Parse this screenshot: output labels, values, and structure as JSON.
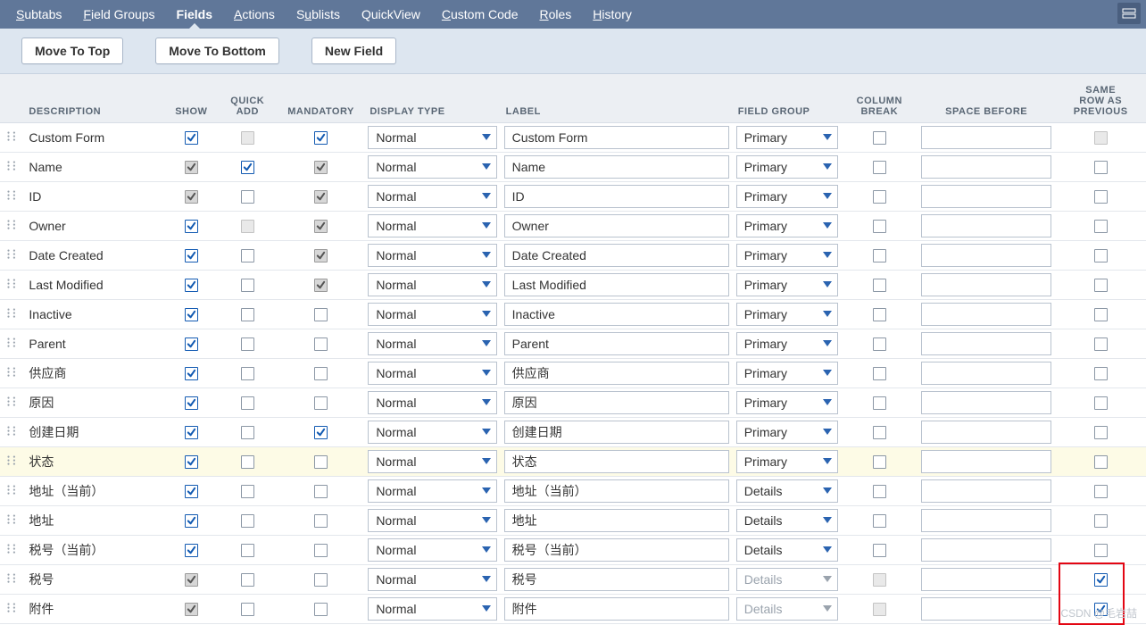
{
  "nav": {
    "tabs": [
      {
        "key": "subtabs",
        "label": "Subtabs",
        "u": 0,
        "active": false
      },
      {
        "key": "field-groups",
        "label": "Field Groups",
        "u": 0,
        "active": false
      },
      {
        "key": "fields",
        "label": "Fields",
        "u": -1,
        "active": true
      },
      {
        "key": "actions",
        "label": "Actions",
        "u": 0,
        "active": false
      },
      {
        "key": "sublists",
        "label": "Sublists",
        "u": 1,
        "active": false
      },
      {
        "key": "quickview",
        "label": "QuickView",
        "u": -1,
        "active": false
      },
      {
        "key": "custom-code",
        "label": "Custom Code",
        "u": 0,
        "active": false
      },
      {
        "key": "roles",
        "label": "Roles",
        "u": 0,
        "active": false
      },
      {
        "key": "history",
        "label": "History",
        "u": 0,
        "active": false
      }
    ]
  },
  "toolbar": {
    "move_top": "Move To Top",
    "move_bottom": "Move To Bottom",
    "new_field": "New Field"
  },
  "columns": {
    "description": "DESCRIPTION",
    "show": "SHOW",
    "quick_add": "QUICK\nADD",
    "mandatory": "MANDATORY",
    "display_type": "DISPLAY TYPE",
    "label": "LABEL",
    "field_group": "FIELD GROUP",
    "column_break": "COLUMN\nBREAK",
    "space_before": "SPACE BEFORE",
    "same_row": "SAME\nROW AS\nPREVIOUS"
  },
  "display_type_options": [
    "Normal"
  ],
  "field_group_options": [
    "Primary",
    "Details"
  ],
  "rows": [
    {
      "desc": "Custom Form",
      "show": "blue",
      "quick": "disabled",
      "mand": "blue",
      "display": "Normal",
      "label": "Custom Form",
      "group": "Primary",
      "groupDisabled": false,
      "colbreak": "off",
      "space": "",
      "same": "disabled",
      "hl": false
    },
    {
      "desc": "Name",
      "show": "gray",
      "quick": "blue",
      "mand": "gray",
      "display": "Normal",
      "label": "Name",
      "group": "Primary",
      "groupDisabled": false,
      "colbreak": "off",
      "space": "",
      "same": "off",
      "hl": false
    },
    {
      "desc": "ID",
      "show": "gray",
      "quick": "off",
      "mand": "gray",
      "display": "Normal",
      "label": "ID",
      "group": "Primary",
      "groupDisabled": false,
      "colbreak": "off",
      "space": "",
      "same": "off",
      "hl": false
    },
    {
      "desc": "Owner",
      "show": "blue",
      "quick": "disabled",
      "mand": "gray",
      "display": "Normal",
      "label": "Owner",
      "group": "Primary",
      "groupDisabled": false,
      "colbreak": "off",
      "space": "",
      "same": "off",
      "hl": false
    },
    {
      "desc": "Date Created",
      "show": "blue",
      "quick": "off",
      "mand": "gray",
      "display": "Normal",
      "label": "Date Created",
      "group": "Primary",
      "groupDisabled": false,
      "colbreak": "off",
      "space": "",
      "same": "off",
      "hl": false
    },
    {
      "desc": "Last Modified",
      "show": "blue",
      "quick": "off",
      "mand": "gray",
      "display": "Normal",
      "label": "Last Modified",
      "group": "Primary",
      "groupDisabled": false,
      "colbreak": "off",
      "space": "",
      "same": "off",
      "hl": false
    },
    {
      "desc": "Inactive",
      "show": "blue",
      "quick": "off",
      "mand": "off",
      "display": "Normal",
      "label": "Inactive",
      "group": "Primary",
      "groupDisabled": false,
      "colbreak": "off",
      "space": "",
      "same": "off",
      "hl": false
    },
    {
      "desc": "Parent",
      "show": "blue",
      "quick": "off",
      "mand": "off",
      "display": "Normal",
      "label": "Parent",
      "group": "Primary",
      "groupDisabled": false,
      "colbreak": "off",
      "space": "",
      "same": "off",
      "hl": false
    },
    {
      "desc": "供应商",
      "show": "blue",
      "quick": "off",
      "mand": "off",
      "display": "Normal",
      "label": "供应商",
      "group": "Primary",
      "groupDisabled": false,
      "colbreak": "off",
      "space": "",
      "same": "off",
      "hl": false
    },
    {
      "desc": "原因",
      "show": "blue",
      "quick": "off",
      "mand": "off",
      "display": "Normal",
      "label": "原因",
      "group": "Primary",
      "groupDisabled": false,
      "colbreak": "off",
      "space": "",
      "same": "off",
      "hl": false
    },
    {
      "desc": "创建日期",
      "show": "blue",
      "quick": "off",
      "mand": "blue",
      "display": "Normal",
      "label": "创建日期",
      "group": "Primary",
      "groupDisabled": false,
      "colbreak": "off",
      "space": "",
      "same": "off",
      "hl": false
    },
    {
      "desc": "状态",
      "show": "blue",
      "quick": "off",
      "mand": "off",
      "display": "Normal",
      "label": "状态",
      "group": "Primary",
      "groupDisabled": false,
      "colbreak": "off",
      "space": "",
      "same": "off",
      "hl": true
    },
    {
      "desc": "地址（当前）",
      "show": "blue",
      "quick": "off",
      "mand": "off",
      "display": "Normal",
      "label": "地址（当前）",
      "group": "Details",
      "groupDisabled": false,
      "colbreak": "off",
      "space": "",
      "same": "off",
      "hl": false
    },
    {
      "desc": "地址",
      "show": "blue",
      "quick": "off",
      "mand": "off",
      "display": "Normal",
      "label": "地址",
      "group": "Details",
      "groupDisabled": false,
      "colbreak": "off",
      "space": "",
      "same": "off",
      "hl": false
    },
    {
      "desc": "税号（当前）",
      "show": "blue",
      "quick": "off",
      "mand": "off",
      "display": "Normal",
      "label": "税号（当前）",
      "group": "Details",
      "groupDisabled": false,
      "colbreak": "off",
      "space": "",
      "same": "off",
      "hl": false
    },
    {
      "desc": "税号",
      "show": "gray",
      "quick": "off",
      "mand": "off",
      "display": "Normal",
      "label": "税号",
      "group": "Details",
      "groupDisabled": true,
      "colbreak": "disabled",
      "space": "",
      "same": "blue",
      "hl": false
    },
    {
      "desc": "附件",
      "show": "gray",
      "quick": "off",
      "mand": "off",
      "display": "Normal",
      "label": "附件",
      "group": "Details",
      "groupDisabled": true,
      "colbreak": "disabled",
      "space": "",
      "same": "blue",
      "hl": false
    }
  ],
  "highlight_box_rows": [
    15,
    16
  ],
  "watermark": "CSDN @毛岩喆"
}
